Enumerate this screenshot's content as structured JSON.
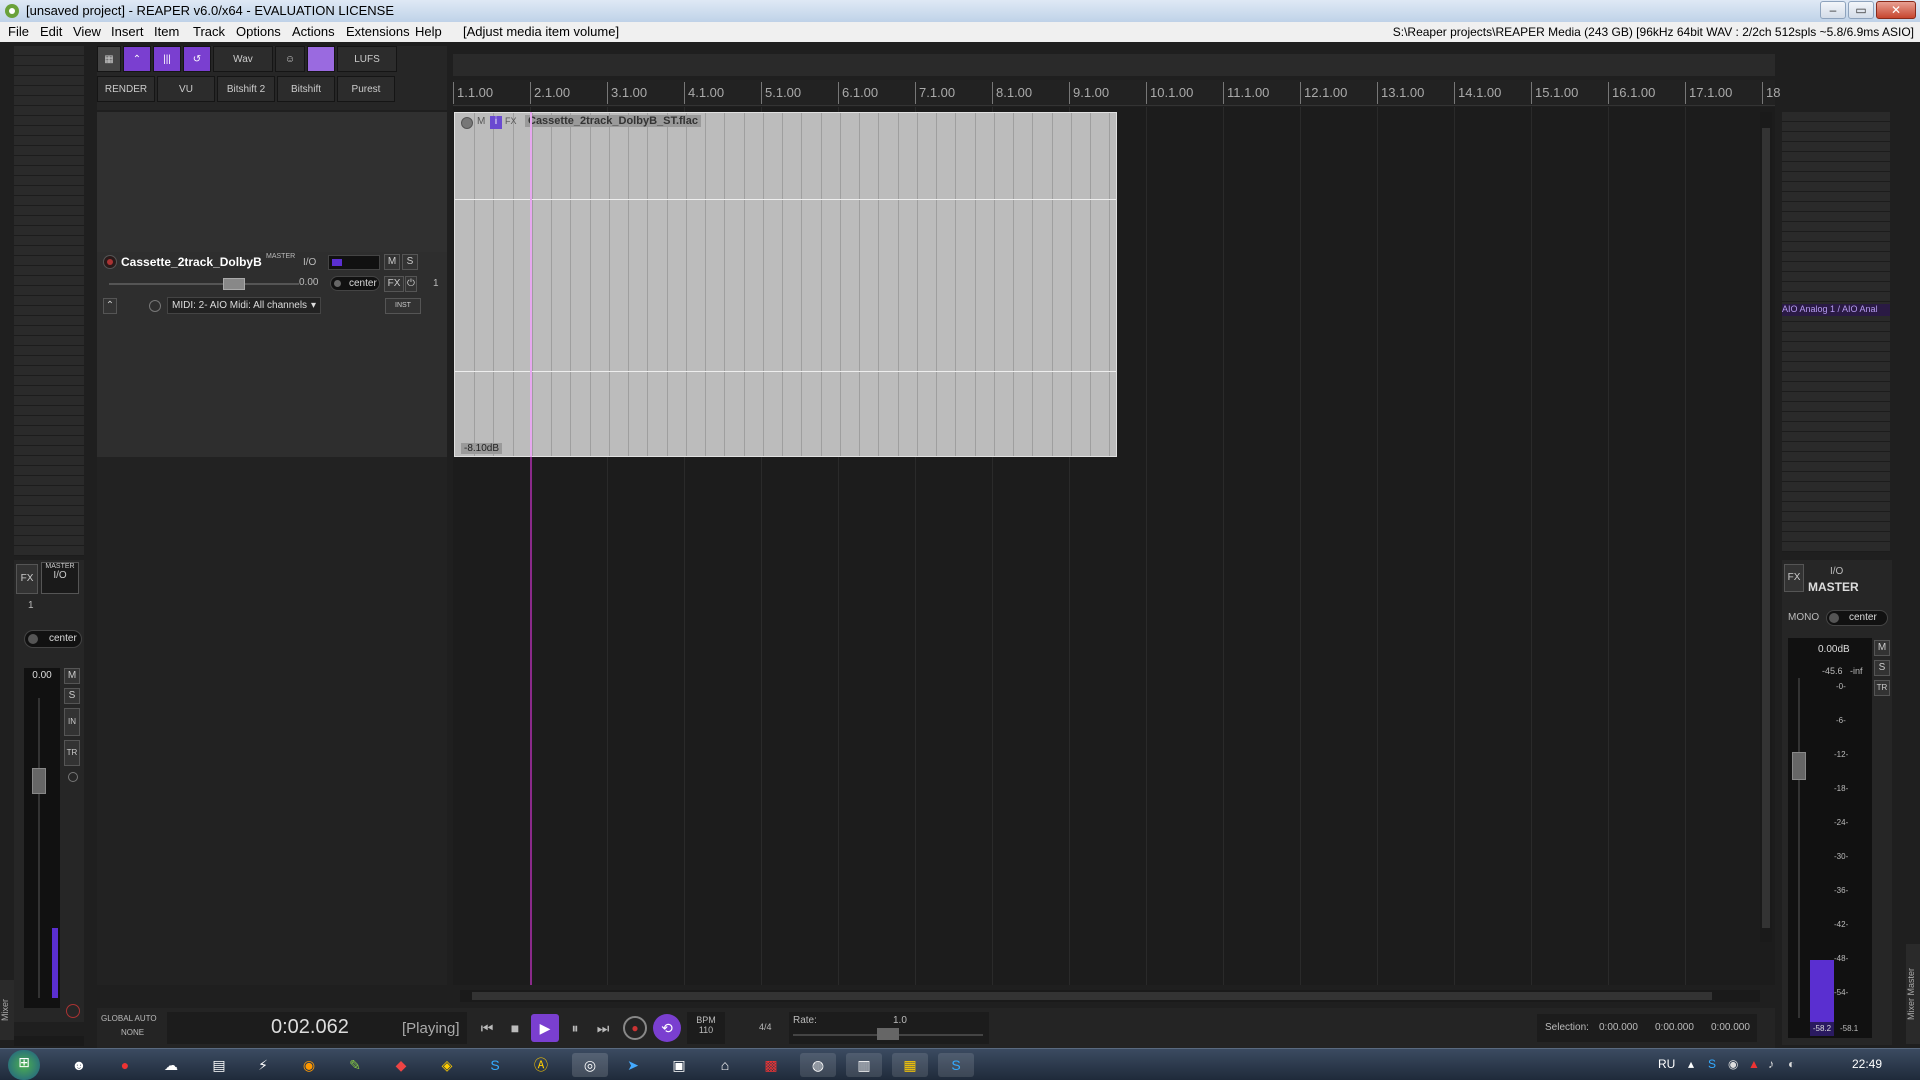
{
  "window": {
    "title": "[unsaved project] - REAPER v6.0/x64 - EVALUATION LICENSE",
    "min": "–",
    "max": "▭",
    "close": "✕"
  },
  "menu": {
    "items": [
      "File",
      "Edit",
      "View",
      "Insert",
      "Item",
      "Track",
      "Options",
      "Actions",
      "Extensions",
      "Help"
    ],
    "action_hint": "[Adjust media item volume]",
    "status": "S:\\Reaper projects\\REAPER Media (243 GB) [96kHz 64bit WAV : 2/2ch 512spls ~5.8/6.9ms ASIO]"
  },
  "toolbar": {
    "row1": [
      "Wav",
      "LUFS"
    ],
    "row2": [
      "RENDER",
      "VU",
      "Bitshift 2",
      "Bitshift",
      "Purest"
    ]
  },
  "ruler": {
    "ticks": [
      "1.1.00",
      "2.1.00",
      "3.1.00",
      "4.1.00",
      "5.1.00",
      "6.1.00",
      "7.1.00",
      "8.1.00",
      "9.1.00",
      "10.1.00",
      "11.1.00",
      "12.1.00",
      "13.1.00",
      "14.1.00",
      "15.1.00",
      "16.1.00",
      "17.1.00",
      "18"
    ]
  },
  "item": {
    "name": "Cassette_2track_DolbyB_ST.flac",
    "volume": "-8.10dB",
    "m": "M",
    "i": "i",
    "fx": "FX"
  },
  "track": {
    "name": "Cassette_2track_DolbyB",
    "master_tag": "MASTER",
    "io": "I/O",
    "m": "M",
    "s": "S",
    "vol": "0.00",
    "pan": "center",
    "fx": "FX",
    "number": "1",
    "input": "MIDI: 2- AIO Midi: All channels",
    "inst": "INST"
  },
  "mixer_left": {
    "master_tag": "MASTER",
    "io": "I/O",
    "fx": "FX",
    "number": "1",
    "pan": "center",
    "vol": "0.00",
    "m": "M",
    "s": "S",
    "in": "IN",
    "tr": "TR",
    "label": "Mixer"
  },
  "bottom": {
    "global_auto": "GLOBAL AUTO",
    "none": "NONE",
    "time": "0:02.062",
    "state": "[Playing]",
    "bpm_label": "BPM",
    "bpm": "110",
    "sig": "4/4",
    "rate_label": "Rate:",
    "rate": "1.0",
    "selection_label": "Selection:",
    "sel_start": "0:00.000",
    "sel_end": "0:00.000",
    "sel_len": "0:00.000"
  },
  "master": {
    "io": "I/O",
    "fx": "FX",
    "title": "MASTER",
    "mono": "MONO",
    "pan": "center",
    "vol": "0.00dB",
    "peak_l": "-45.6",
    "peak_r": "-inf",
    "scale": [
      "-0-",
      "-6-",
      "-12-",
      "-18-",
      "-24-",
      "-30-",
      "-36-",
      "-42-",
      "-48-",
      "-54-"
    ],
    "readout_l": "-58.2",
    "readout_r": "-58.1",
    "m": "M",
    "s": "S",
    "tr": "TR",
    "output": "AIO Analog 1 / AIO Anal",
    "label": "Mixer Master"
  },
  "taskbar": {
    "lang": "RU",
    "clock": "22:49"
  }
}
